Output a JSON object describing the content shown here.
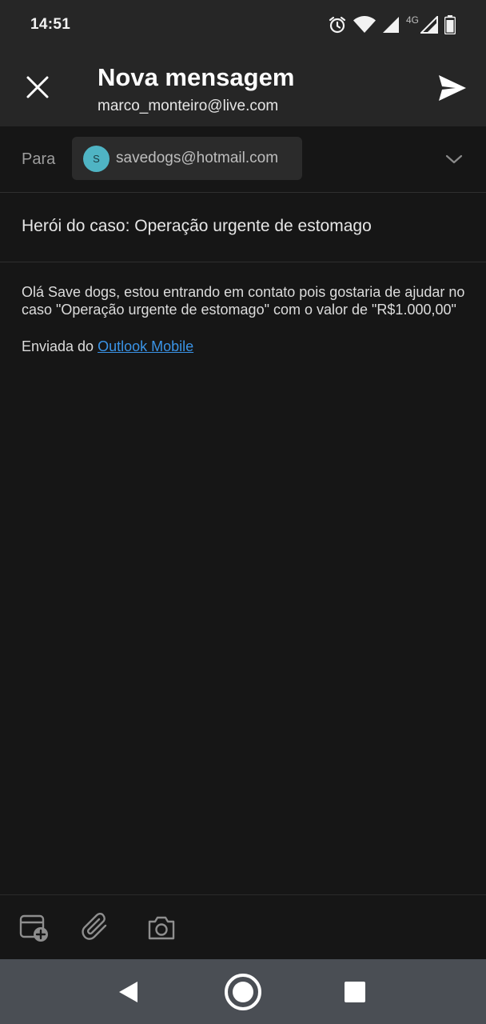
{
  "status_bar": {
    "time": "14:51",
    "network": "4G",
    "battery_level": 0.85,
    "icons": [
      "alarm-icon",
      "wifi-icon",
      "signal-icon",
      "signal-icon",
      "battery-icon"
    ]
  },
  "header": {
    "title": "Nova mensagem",
    "subtitle": "marco_monteiro@live.com"
  },
  "to_field": {
    "label": "Para",
    "recipient": {
      "initial": "S",
      "email": "savedogs@hotmail.com",
      "avatar_color": "#4fb4c4"
    }
  },
  "subject": "Herói do caso: Operação urgente de estomago",
  "body": {
    "text": "Olá Save dogs, estou entrando em contato pois gostaria de ajudar no caso \"Operação urgente de estomago\" com o valor de \"R$1.000,00\"",
    "signature_prefix": "Enviada do ",
    "signature_link": "Outlook Mobile"
  },
  "toolbar": {
    "items": [
      "calendar-add-icon",
      "attach-icon",
      "camera-icon"
    ]
  },
  "colors": {
    "background": "#161616",
    "app_bar": "#262626",
    "link": "#3a93e6",
    "nav_bar": "#4a4e54"
  }
}
